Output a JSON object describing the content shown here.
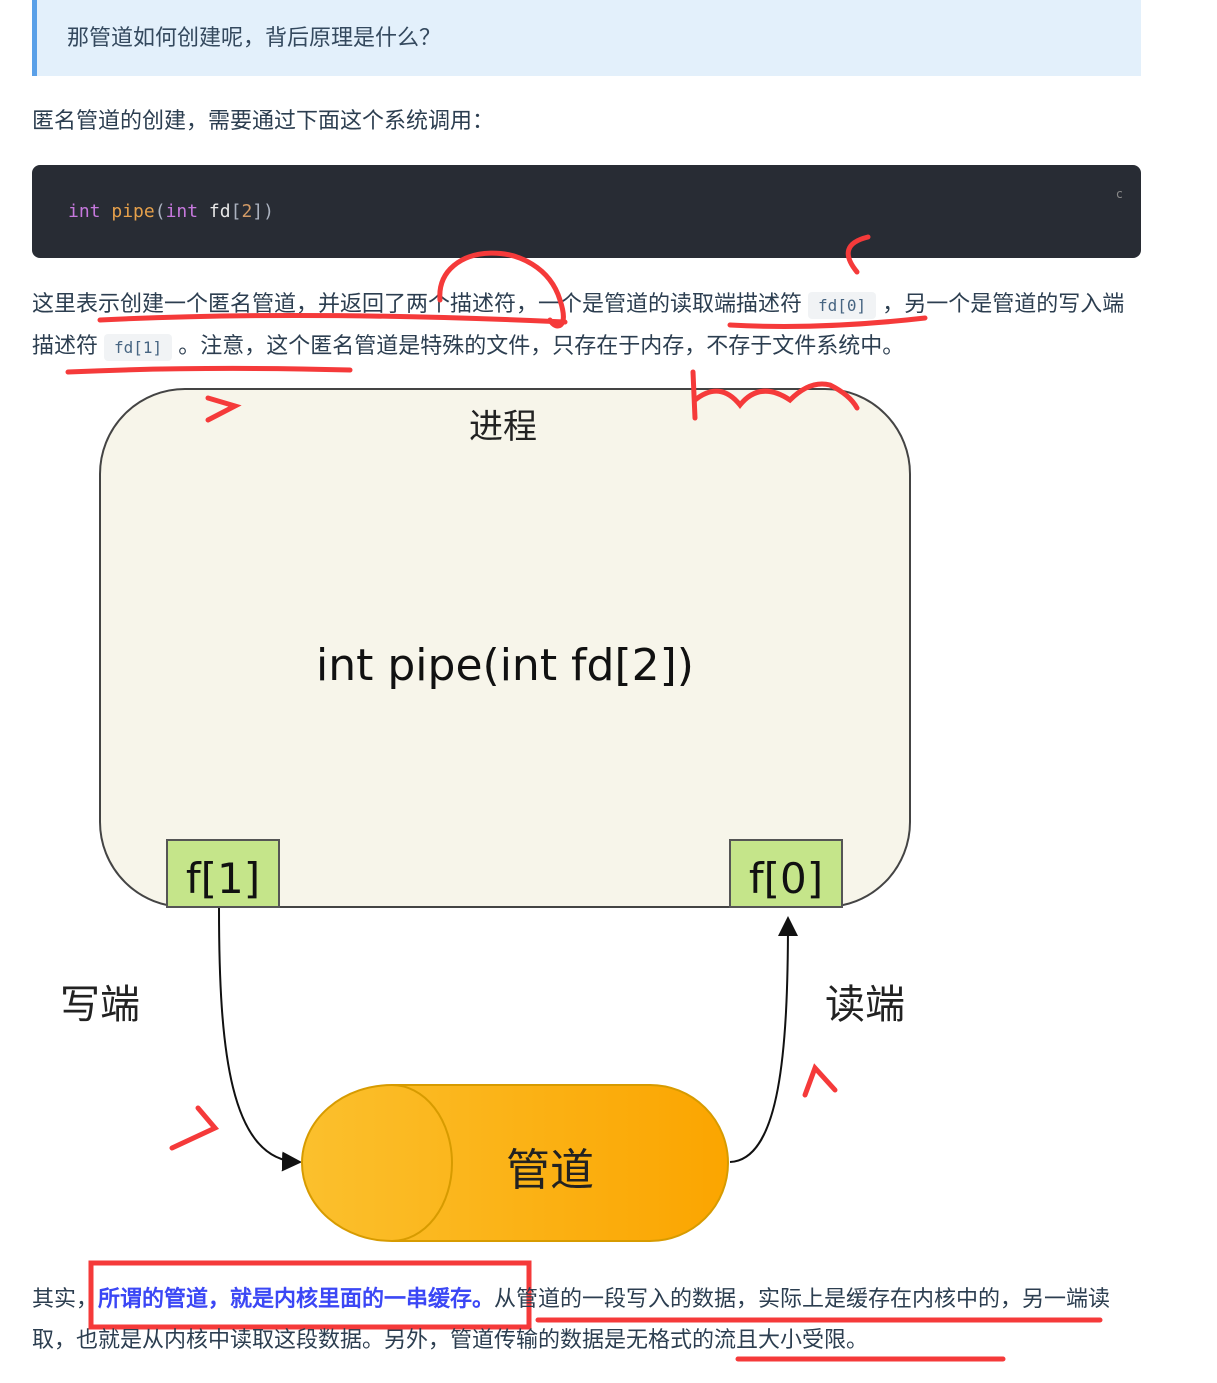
{
  "quote": "那管道如何创建呢，背后原理是什么？",
  "intro": "匿名管道的创建，需要通过下面这个系统调用：",
  "code": {
    "kw1": "int",
    "fn": "pipe",
    "open": "(",
    "kw2": "int",
    "id": "fd",
    "lb": "[",
    "num": "2",
    "close": "])",
    "lang": "c"
  },
  "para1": {
    "a": "这里表示创建一个匿名管道，并返回了两个描述符，一个是管道的读取端描述符",
    "c1": "fd[0]",
    "b": "，另一个是管道的写入端描述符",
    "c2": "fd[1]",
    "c": "。注意，这个匿名管道是特殊的文件，只存在于内存，不存于文件系统中。"
  },
  "diagram": {
    "process": "进程",
    "call": "int pipe(int fd[2])",
    "f1": "f[1]",
    "f0": "f[0]",
    "write": "写端",
    "read": "读端",
    "pipe": "管道"
  },
  "para2": {
    "a": "其实，",
    "hl": "所谓的管道，就是内核里面的一串缓存。",
    "b": "从管道的一段写入的数据，实际上是缓存在内核中的，另一端读取，也就是从内核中读取这段数据。另外，管道传输的数据是无格式的流且大小受限。"
  },
  "colors": {
    "annotation": "#f53a3a",
    "highlight": "#3b47f5",
    "code_bg": "#282c34",
    "quote_bg": "#e3f0fb",
    "fd_box": "#c5e58a",
    "pipe": "#fbb315"
  }
}
